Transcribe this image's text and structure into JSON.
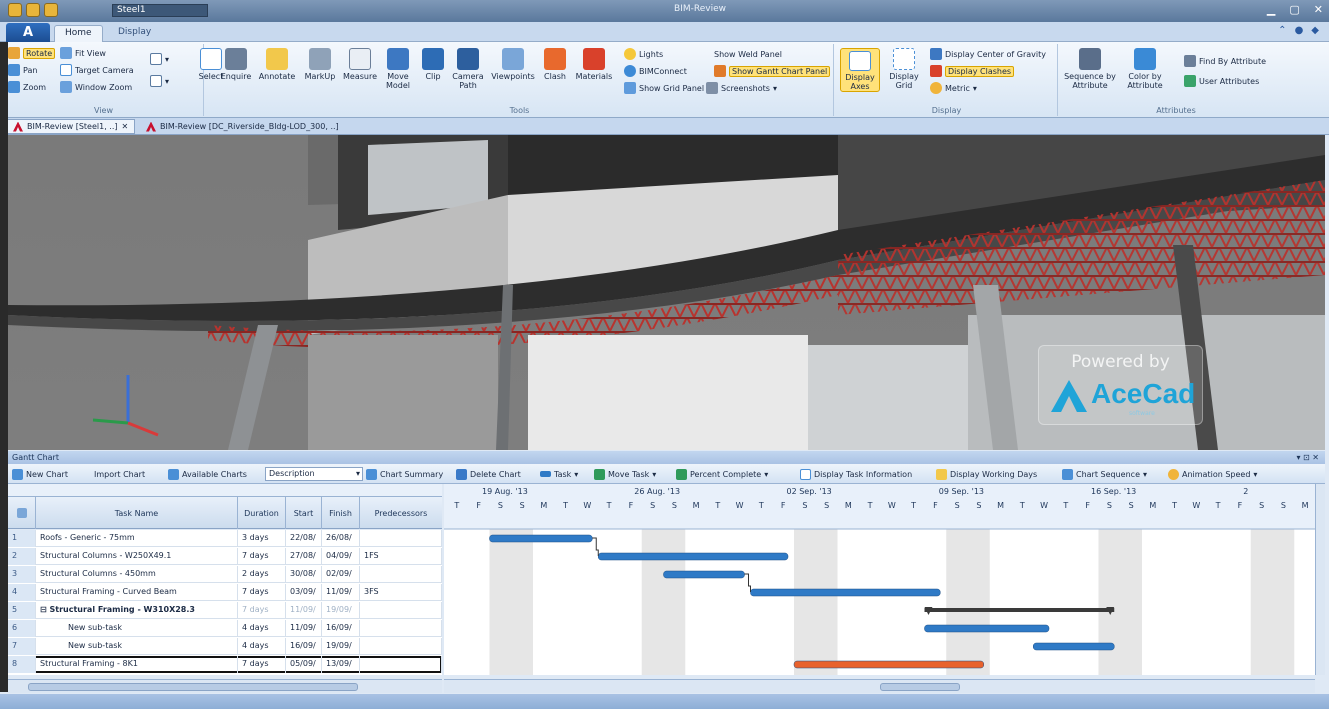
{
  "window": {
    "title": "BIM-Review",
    "document_box": "Steel1"
  },
  "ribbon_tabs": [
    "Home",
    "Display"
  ],
  "ribbon": {
    "view": {
      "label": "View",
      "rotate": "Rotate",
      "pan": "Pan",
      "zoom": "Zoom",
      "fit_view": "Fit View",
      "target_camera": "Target Camera",
      "window_zoom": "Window Zoom"
    },
    "tools": {
      "label": "Tools",
      "select": "Select",
      "enquire": "Enquire",
      "annotate": "Annotate",
      "markup": "MarkUp",
      "measure": "Measure",
      "move_model": "Move Model",
      "clip": "Clip",
      "camera_path": "Camera Path",
      "viewpoints": "Viewpoints",
      "clash": "Clash",
      "materials": "Materials",
      "lights": "Lights",
      "bimconnect": "BIMConnect",
      "show_grid_panel": "Show Grid Panel",
      "show_weld_panel": "Show Weld Panel",
      "show_gantt_chart_panel": "Show Gantt Chart Panel",
      "screenshots": "Screenshots"
    },
    "display": {
      "label": "Display",
      "display_axes": "Display Axes",
      "display_grid": "Display Grid",
      "display_center_of_gravity": "Display Center of Gravity",
      "display_clashes": "Display Clashes",
      "metric": "Metric"
    },
    "attributes": {
      "label": "Attributes",
      "sequence_by_attribute": "Sequence by Attribute",
      "color_by_attribute": "Color by Attribute",
      "find_by_attribute": "Find By Attribute",
      "user_attributes": "User Attributes"
    }
  },
  "doc_tabs": [
    "BIM-Review [Steel1, ..]",
    "BIM-Review [DC_Riverside_Bldg-LOD_300, ..]"
  ],
  "watermark": {
    "powered": "Powered by",
    "brand": "AceCad",
    "sub": "software",
    "brand_color": "#1fa4d8"
  },
  "gantt": {
    "title": "Gantt Chart",
    "toolbar": {
      "new_chart": "New Chart",
      "import_chart": "Import Chart",
      "available_charts": "Available Charts",
      "description": "Description",
      "chart_summary": "Chart Summary",
      "delete_chart": "Delete Chart",
      "task": "Task",
      "move_task": "Move Task",
      "percent_complete": "Percent Complete",
      "display_task_information": "Display Task Information",
      "display_working_days": "Display Working Days",
      "chart_sequence": "Chart Sequence",
      "animation_speed": "Animation Speed"
    },
    "columns": {
      "task_name": "Task Name",
      "duration": "Duration",
      "start": "Start",
      "finish": "Finish",
      "predecessors": "Predecessors"
    },
    "rows": [
      {
        "id": "1",
        "name": "Roofs - Generic - 75mm",
        "duration": "3 days",
        "start": "22/08/",
        "finish": "26/08/",
        "pred": ""
      },
      {
        "id": "2",
        "name": "Structural Columns - W250X49.1",
        "duration": "7 days",
        "start": "27/08/",
        "finish": "04/09/",
        "pred": "1FS"
      },
      {
        "id": "3",
        "name": "Structural Columns - 450mm",
        "duration": "2 days",
        "start": "30/08/",
        "finish": "02/09/",
        "pred": ""
      },
      {
        "id": "4",
        "name": "Structural Framing - Curved Beam",
        "duration": "7 days",
        "start": "03/09/",
        "finish": "11/09/",
        "pred": "3FS"
      },
      {
        "id": "5",
        "name": "Structural Framing - W310X28.3",
        "duration": "7 days",
        "start": "11/09/",
        "finish": "19/09/",
        "pred": ""
      },
      {
        "id": "6",
        "name": "New sub-task",
        "duration": "4 days",
        "start": "11/09/",
        "finish": "16/09/",
        "pred": ""
      },
      {
        "id": "7",
        "name": "New sub-task",
        "duration": "4 days",
        "start": "16/09/",
        "finish": "19/09/",
        "pred": ""
      },
      {
        "id": "8",
        "name": "Structural Framing - 8K1",
        "duration": "7 days",
        "start": "05/09/",
        "finish": "13/09/",
        "pred": ""
      }
    ],
    "weeks": [
      "19 Aug. '13",
      "26 Aug. '13",
      "02 Sep. '13",
      "09 Sep. '13",
      "16 Sep. '13",
      "2"
    ],
    "day_letters": [
      "T",
      "F",
      "S",
      "S",
      "M",
      "T",
      "W",
      "T",
      "F",
      "S",
      "S",
      "M",
      "T",
      "W",
      "T",
      "F",
      "S",
      "S",
      "M",
      "T",
      "W",
      "T",
      "F",
      "S",
      "S",
      "M",
      "T",
      "W",
      "T",
      "F",
      "S",
      "S",
      "M",
      "T",
      "W",
      "T",
      "F",
      "S",
      "S",
      "M"
    ],
    "timeline_start_day_index": 0,
    "bar_color": "#2f7ac6",
    "selected_bar_color": "#e8622d",
    "summary_bar_color": "#3a3a3a"
  }
}
